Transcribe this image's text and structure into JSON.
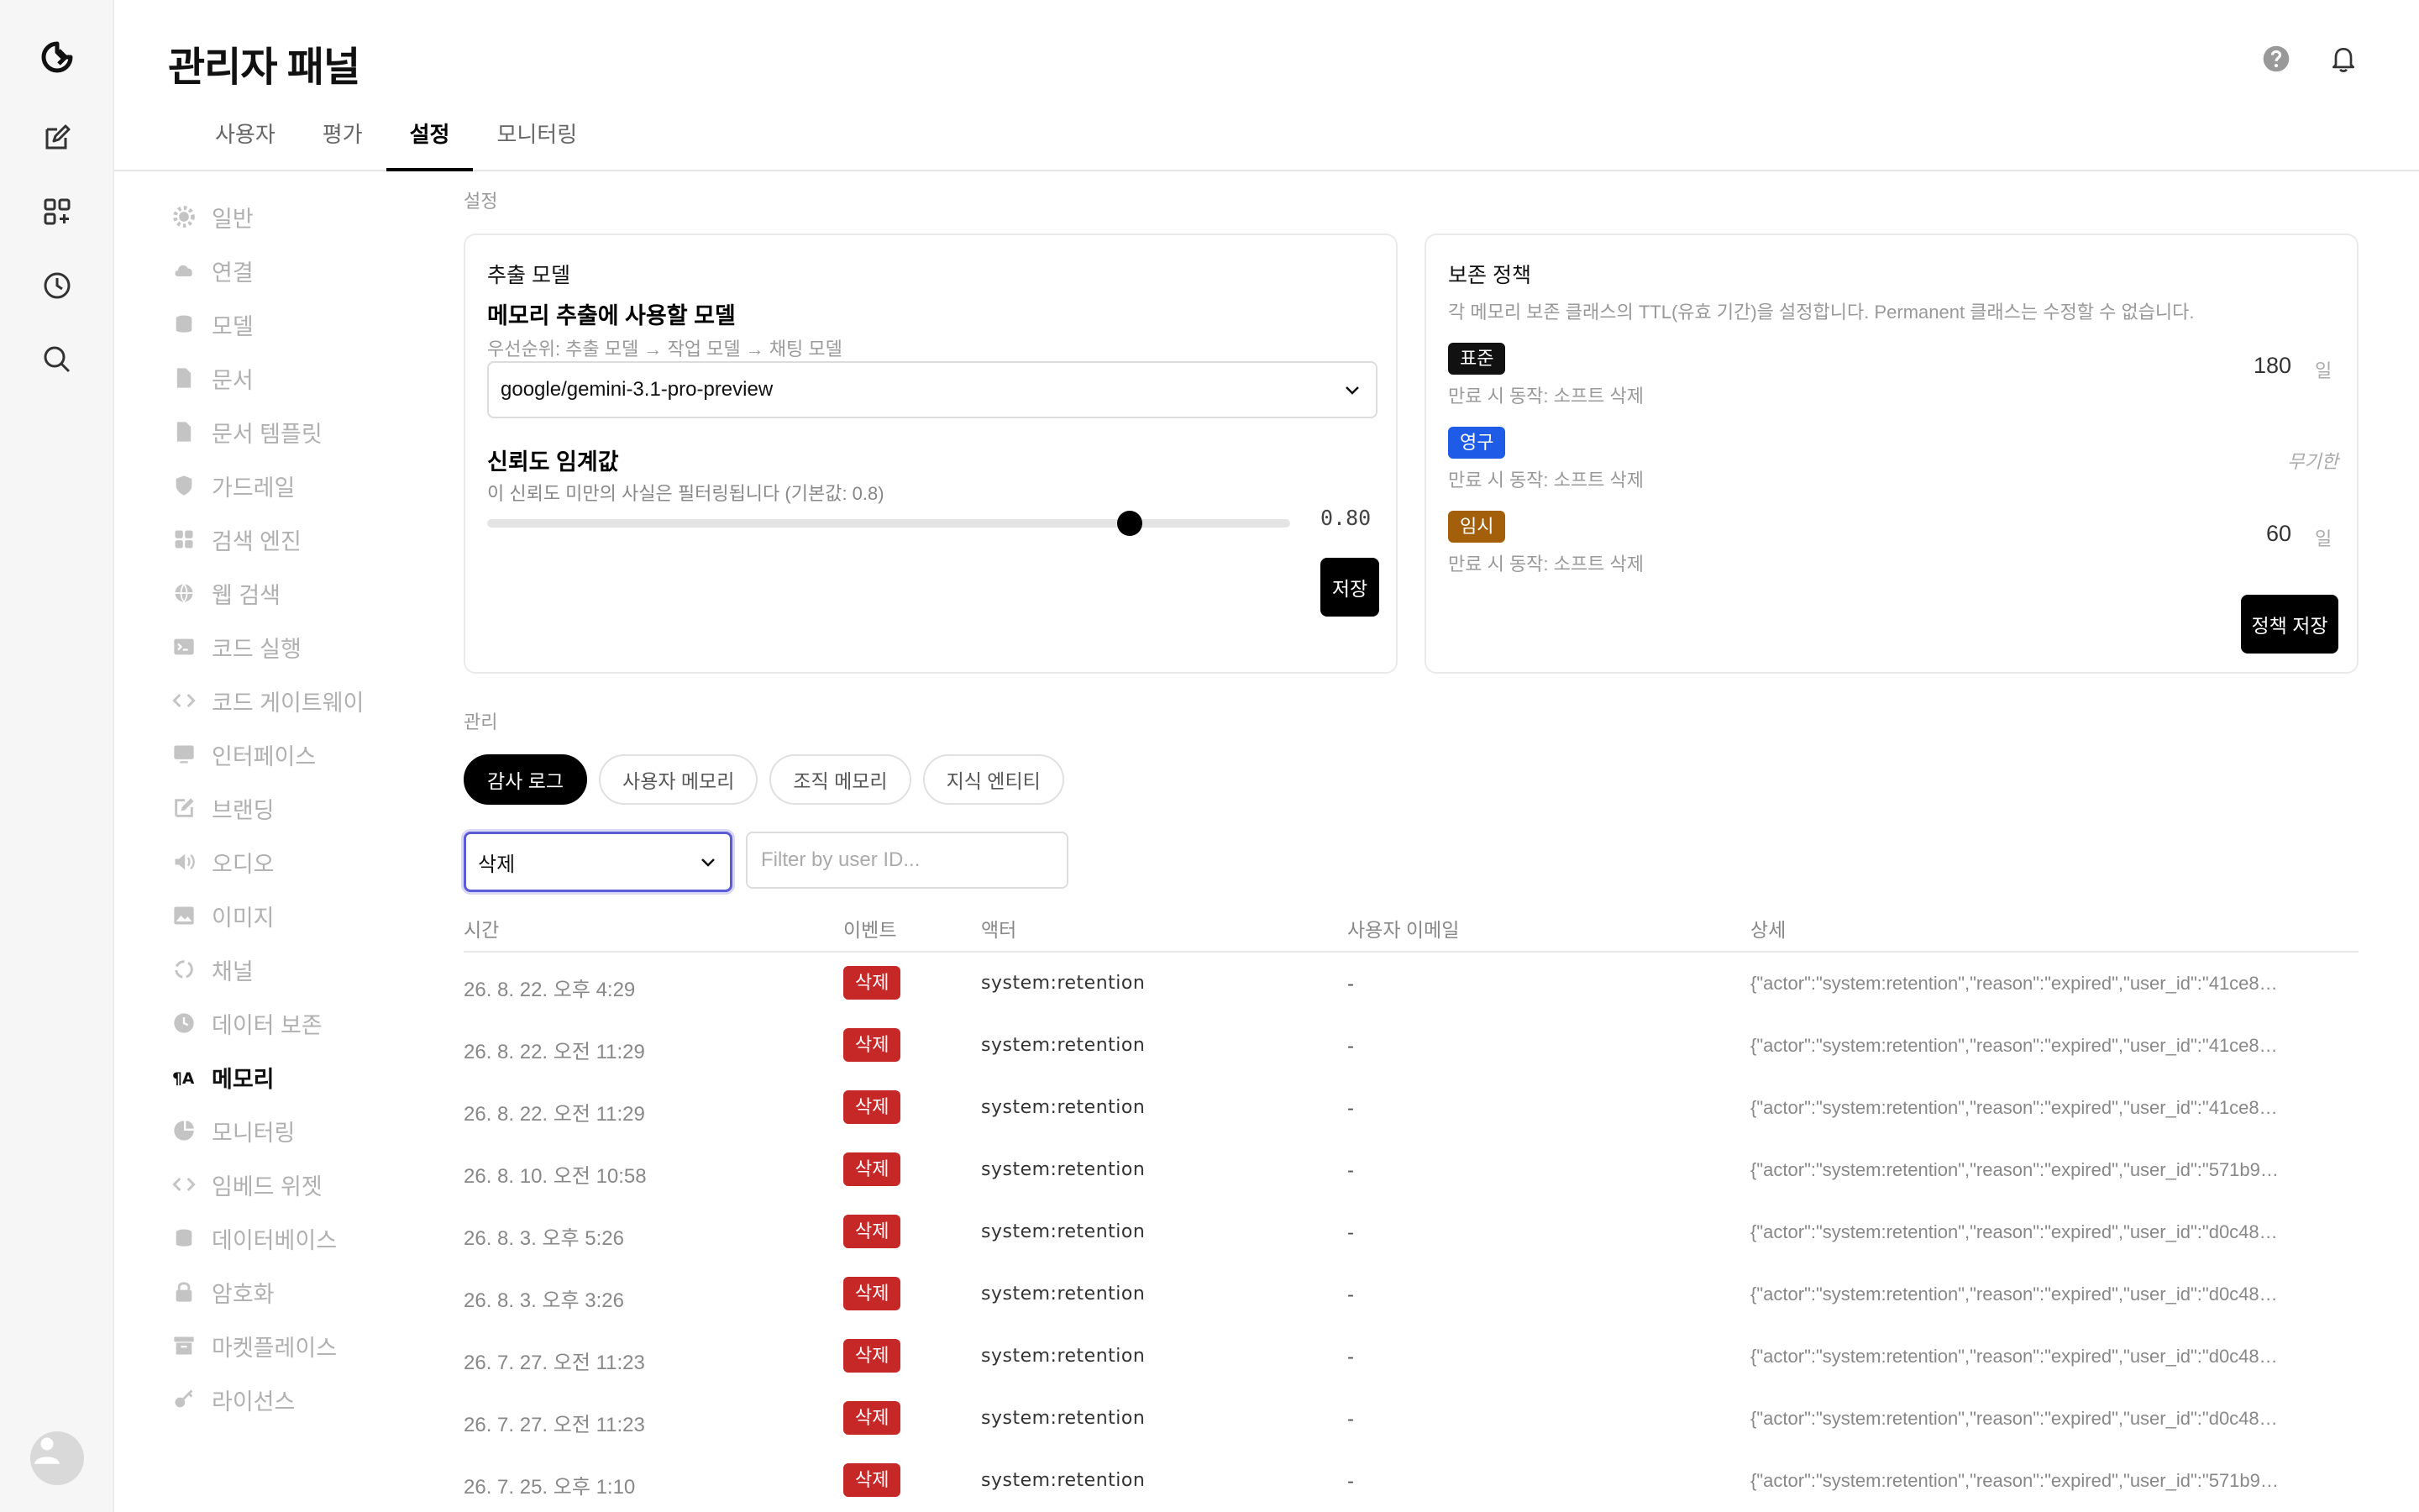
{
  "app": {
    "title": "관리자 패널"
  },
  "tabs": [
    {
      "label": "사용자"
    },
    {
      "label": "평가"
    },
    {
      "label": "설정"
    },
    {
      "label": "모니터링"
    }
  ],
  "subnav": [
    {
      "label": "일반",
      "icon": "gear-icon"
    },
    {
      "label": "연결",
      "icon": "cloud-icon"
    },
    {
      "label": "모델",
      "icon": "database-icon"
    },
    {
      "label": "문서",
      "icon": "document-icon"
    },
    {
      "label": "문서 템플릿",
      "icon": "document-icon"
    },
    {
      "label": "가드레일",
      "icon": "shield-icon"
    },
    {
      "label": "검색 엔진",
      "icon": "grid-icon"
    },
    {
      "label": "웹 검색",
      "icon": "globe-icon"
    },
    {
      "label": "코드 실행",
      "icon": "terminal-icon"
    },
    {
      "label": "코드 게이트웨이",
      "icon": "code-icon"
    },
    {
      "label": "인터페이스",
      "icon": "monitor-icon"
    },
    {
      "label": "브랜딩",
      "icon": "pencil-icon"
    },
    {
      "label": "오디오",
      "icon": "speaker-icon"
    },
    {
      "label": "이미지",
      "icon": "image-icon"
    },
    {
      "label": "채널",
      "icon": "channel-icon"
    },
    {
      "label": "데이터 보존",
      "icon": "clock-icon"
    },
    {
      "label": "메모리",
      "icon": "memory-icon",
      "active": true
    },
    {
      "label": "모니터링",
      "icon": "chart-icon"
    },
    {
      "label": "임베드 위젯",
      "icon": "code-icon"
    },
    {
      "label": "데이터베이스",
      "icon": "database-icon"
    },
    {
      "label": "암호화",
      "icon": "lock-icon"
    },
    {
      "label": "마켓플레이스",
      "icon": "archive-icon"
    },
    {
      "label": "라이선스",
      "icon": "key-icon"
    }
  ],
  "settings": {
    "section_label": "설정",
    "extraction": {
      "card_title": "추출 모델",
      "heading": "메모리 추출에 사용할 모델",
      "priority_hint": "우선순위: 추출 모델 → 작업 모델 → 채팅 모델",
      "selected_model": "google/gemini-3.1-pro-preview",
      "threshold_heading": "신뢰도 임계값",
      "threshold_hint": "이 신뢰도 미만의 사실은 필터링됩니다 (기본값: 0.8)",
      "threshold_value": "0.80",
      "threshold_fraction": 0.8,
      "save_label": "저장"
    },
    "retention": {
      "card_title": "보존 정책",
      "description": "각 메모리 보존 클래스의 TTL(유효 기간)을 설정합니다. Permanent 클래스는 수정할 수 없습니다.",
      "classes": [
        {
          "badge": "표준",
          "color": "#111111",
          "action": "만료 시 동작: 소프트 삭제",
          "value": "180",
          "unit": "일"
        },
        {
          "badge": "영구",
          "color": "#1e5be6",
          "action": "만료 시 동작: 소프트 삭제",
          "value": "무기한",
          "unit": ""
        },
        {
          "badge": "임시",
          "color": "#a35f0a",
          "action": "만료 시 동작: 소프트 삭제",
          "value": "60",
          "unit": "일"
        }
      ],
      "save_label": "정책 저장"
    }
  },
  "management": {
    "section_label": "관리",
    "pills": [
      {
        "label": "감사 로그",
        "active": true
      },
      {
        "label": "사용자 메모리"
      },
      {
        "label": "조직 메모리"
      },
      {
        "label": "지식 엔티티"
      }
    ],
    "filter_event": "삭제",
    "filter_placeholder": "Filter by user ID...",
    "columns": {
      "time": "시간",
      "event": "이벤트",
      "actor": "액터",
      "email": "사용자 이메일",
      "detail": "상세"
    },
    "rows": [
      {
        "time": "26. 8. 22. 오후 4:29",
        "event": "삭제",
        "actor": "system:retention",
        "email": "-",
        "detail": "{\"actor\":\"system:retention\",\"reason\":\"expired\",\"user_id\":\"41ce8…"
      },
      {
        "time": "26. 8. 22. 오전 11:29",
        "event": "삭제",
        "actor": "system:retention",
        "email": "-",
        "detail": "{\"actor\":\"system:retention\",\"reason\":\"expired\",\"user_id\":\"41ce8…"
      },
      {
        "time": "26. 8. 22. 오전 11:29",
        "event": "삭제",
        "actor": "system:retention",
        "email": "-",
        "detail": "{\"actor\":\"system:retention\",\"reason\":\"expired\",\"user_id\":\"41ce8…"
      },
      {
        "time": "26. 8. 10. 오전 10:58",
        "event": "삭제",
        "actor": "system:retention",
        "email": "-",
        "detail": "{\"actor\":\"system:retention\",\"reason\":\"expired\",\"user_id\":\"571b9…"
      },
      {
        "time": "26. 8. 3. 오후 5:26",
        "event": "삭제",
        "actor": "system:retention",
        "email": "-",
        "detail": "{\"actor\":\"system:retention\",\"reason\":\"expired\",\"user_id\":\"d0c48…"
      },
      {
        "time": "26. 8. 3. 오후 3:26",
        "event": "삭제",
        "actor": "system:retention",
        "email": "-",
        "detail": "{\"actor\":\"system:retention\",\"reason\":\"expired\",\"user_id\":\"d0c48…"
      },
      {
        "time": "26. 7. 27. 오전 11:23",
        "event": "삭제",
        "actor": "system:retention",
        "email": "-",
        "detail": "{\"actor\":\"system:retention\",\"reason\":\"expired\",\"user_id\":\"d0c48…"
      },
      {
        "time": "26. 7. 27. 오전 11:23",
        "event": "삭제",
        "actor": "system:retention",
        "email": "-",
        "detail": "{\"actor\":\"system:retention\",\"reason\":\"expired\",\"user_id\":\"d0c48…"
      },
      {
        "time": "26. 7. 25. 오후 1:10",
        "event": "삭제",
        "actor": "system:retention",
        "email": "-",
        "detail": "{\"actor\":\"system:retention\",\"reason\":\"expired\",\"user_id\":\"571b9…"
      }
    ]
  }
}
